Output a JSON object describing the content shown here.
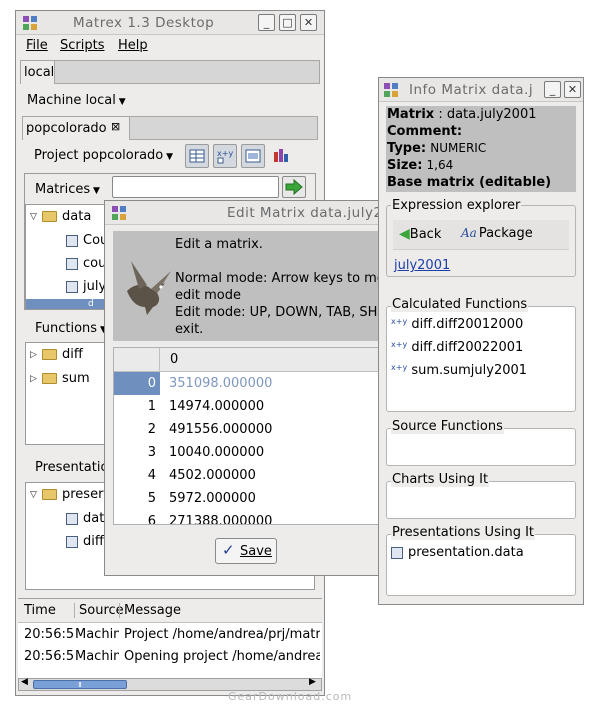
{
  "main": {
    "title": "Matrex 1.3 Desktop",
    "menu": [
      "File",
      "Scripts",
      "Help"
    ],
    "machine_tab": "local",
    "machine_combo": "Machine local",
    "project_tab": "popcolorado",
    "project_combo": "Project popcolorado",
    "matrices_combo": "Matrices",
    "matrices_search": "",
    "matrices_tree": {
      "root": "data",
      "items": [
        "Cou",
        "cou",
        "july",
        "d"
      ]
    },
    "functions_combo": "Functions",
    "functions_tree": [
      "diff",
      "sum"
    ],
    "presentations_combo": "Presentation",
    "presentations_tree": {
      "root": "preser",
      "items": [
        "data",
        "diff"
      ]
    },
    "log": {
      "headers": [
        "Time",
        "Source",
        "Message"
      ],
      "rows": [
        [
          "20:56:5",
          "Machin",
          "Project /home/andrea/prj/matr"
        ],
        [
          "20:56:5",
          "Machin",
          "Opening project /home/andrea"
        ]
      ]
    },
    "scrollbar_grip": "Ⅱ"
  },
  "edit": {
    "title": "Edit Matrix data.july2",
    "help_lines": [
      "Edit a matrix.",
      "",
      "Normal mode: Arrow keys to mo",
      "edit mode",
      "Edit mode: UP, DOWN, TAB, SHI",
      "exit."
    ],
    "column_header": "0",
    "rows": [
      {
        "index": "0",
        "value": "351098.000000"
      },
      {
        "index": "1",
        "value": "14974.000000"
      },
      {
        "index": "2",
        "value": "491556.000000"
      },
      {
        "index": "3",
        "value": "10040.000000"
      },
      {
        "index": "4",
        "value": "4502.000000"
      },
      {
        "index": "5",
        "value": "5972.000000"
      },
      {
        "index": "6",
        "value": "271388.000000"
      }
    ],
    "save_label": "Save"
  },
  "info": {
    "title": "Info Matrix data.j",
    "matrix_label": "Matrix",
    "matrix_value": "data.july2001",
    "comment_label": "Comment:",
    "type_label": "Type:",
    "type_value": "NUMERIC",
    "size_label": "Size:",
    "size_value": "1,64",
    "base": "Base matrix (editable)",
    "explorer_title": "Expression explorer",
    "back_label": "Back",
    "package_label": "Package",
    "package_glyph": "Aa",
    "link": "july2001",
    "calc_title": "Calculated Functions",
    "calc_items": [
      "diff.diff20012000",
      "diff.diff20022001",
      "sum.sumjuly2001"
    ],
    "source_title": "Source Functions",
    "charts_title": "Charts Using It",
    "pres_title": "Presentations Using It",
    "pres_items": [
      "presentation.data"
    ]
  },
  "watermark": "GearDownload.com",
  "colors": {
    "selection": "#6f8fbf",
    "link": "#1d3fa8",
    "gray_block": "#bfbfbf"
  }
}
